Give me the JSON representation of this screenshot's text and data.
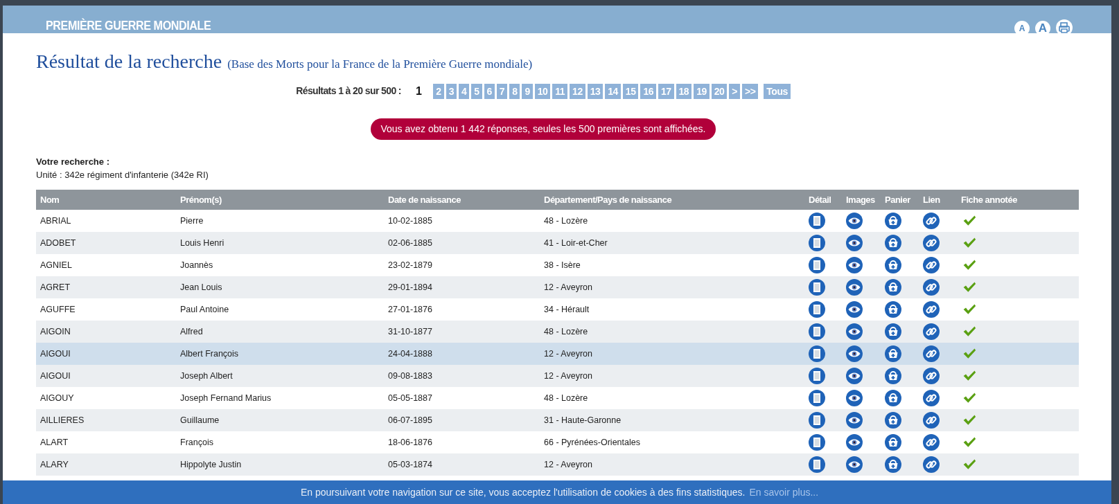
{
  "header": {
    "title": "PREMIÈRE GUERRE MONDIALE",
    "font_buttons": [
      {
        "label": "A",
        "kind": "small"
      },
      {
        "label": "A",
        "kind": "large"
      }
    ]
  },
  "heading": {
    "title": "Résultat de la recherche",
    "subtitle": "(Base des Morts pour la France de la Première Guerre mondiale)"
  },
  "pagination": {
    "summary": "Résultats 1 à 20 sur 500 :",
    "pages": [
      {
        "label": "1",
        "selected": true
      },
      {
        "label": "2",
        "selected": false
      },
      {
        "label": "3",
        "selected": false
      },
      {
        "label": "4",
        "selected": false
      },
      {
        "label": "5",
        "selected": false
      },
      {
        "label": "6",
        "selected": false
      },
      {
        "label": "7",
        "selected": false
      },
      {
        "label": "8",
        "selected": false
      },
      {
        "label": "9",
        "selected": false
      },
      {
        "label": "10",
        "selected": false
      },
      {
        "label": "11",
        "selected": false
      },
      {
        "label": "12",
        "selected": false
      },
      {
        "label": "13",
        "selected": false
      },
      {
        "label": "14",
        "selected": false
      },
      {
        "label": "15",
        "selected": false
      },
      {
        "label": "16",
        "selected": false
      },
      {
        "label": "17",
        "selected": false
      },
      {
        "label": "18",
        "selected": false
      },
      {
        "label": "19",
        "selected": false
      },
      {
        "label": "20",
        "selected": false
      },
      {
        "label": ">",
        "selected": false
      },
      {
        "label": ">>",
        "selected": false
      }
    ],
    "all": "Tous"
  },
  "alert": "Vous avez obtenu 1 442 réponses, seules les 500 premières sont affichées.",
  "search": {
    "label": "Votre recherche :",
    "criteria": "Unité : 342e régiment d'infanterie (342e RI)"
  },
  "table": {
    "columns": [
      "Nom",
      "Prénom(s)",
      "Date de naissance",
      "Département/Pays de naissance",
      "Détail",
      "Images",
      "Panier",
      "Lien",
      "Fiche annotée"
    ],
    "rows": [
      {
        "nom": "ABRIAL",
        "prenom": "Pierre",
        "date": "10-02-1885",
        "lieu": "48 - Lozère",
        "annotated": true,
        "selected": false
      },
      {
        "nom": "ADOBET",
        "prenom": "Louis Henri",
        "date": "02-06-1885",
        "lieu": "41 - Loir-et-Cher",
        "annotated": true,
        "selected": false
      },
      {
        "nom": "AGNIEL",
        "prenom": "Joannès",
        "date": "23-02-1879",
        "lieu": "38 - Isère",
        "annotated": true,
        "selected": false
      },
      {
        "nom": "AGRET",
        "prenom": "Jean Louis",
        "date": "29-01-1894",
        "lieu": "12 - Aveyron",
        "annotated": true,
        "selected": false
      },
      {
        "nom": "AGUFFE",
        "prenom": "Paul Antoine",
        "date": "27-01-1876",
        "lieu": "34 - Hérault",
        "annotated": true,
        "selected": false
      },
      {
        "nom": "AIGOIN",
        "prenom": "Alfred",
        "date": "31-10-1877",
        "lieu": "48 - Lozère",
        "annotated": true,
        "selected": false
      },
      {
        "nom": "AIGOUI",
        "prenom": "Albert François",
        "date": "24-04-1888",
        "lieu": "12 - Aveyron",
        "annotated": true,
        "selected": true
      },
      {
        "nom": "AIGOUI",
        "prenom": "Joseph Albert",
        "date": "09-08-1883",
        "lieu": "12 - Aveyron",
        "annotated": true,
        "selected": false
      },
      {
        "nom": "AIGOUY",
        "prenom": "Joseph Fernand Marius",
        "date": "05-05-1887",
        "lieu": "48 - Lozère",
        "annotated": true,
        "selected": false
      },
      {
        "nom": "AILLIERES",
        "prenom": "Guillaume",
        "date": "06-07-1895",
        "lieu": "31 - Haute-Garonne",
        "annotated": true,
        "selected": false
      },
      {
        "nom": "ALART",
        "prenom": "François",
        "date": "18-06-1876",
        "lieu": "66 - Pyrénées-Orientales",
        "annotated": true,
        "selected": false
      },
      {
        "nom": "ALARY",
        "prenom": "Hippolyte Justin",
        "date": "05-03-1874",
        "lieu": "12 - Aveyron",
        "annotated": true,
        "selected": false
      }
    ]
  },
  "cookie_bar": {
    "text": "En poursuivant votre navigation sur ce site, vous acceptez l'utilisation de cookies à des fins statistiques.",
    "link": "En savoir plus..."
  }
}
